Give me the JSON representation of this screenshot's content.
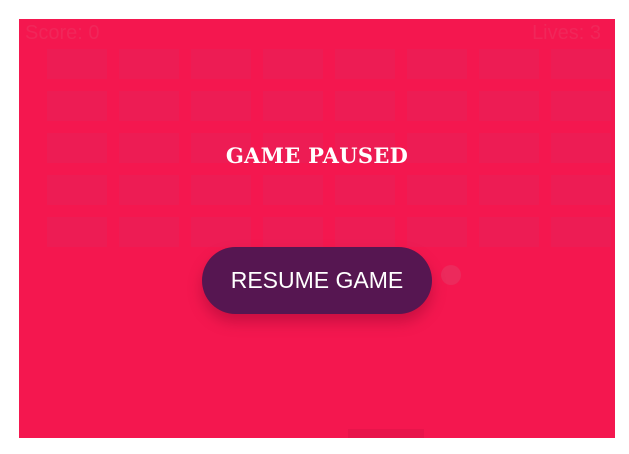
{
  "hud": {
    "score_label": "Score: 0",
    "lives_label": "Lives: 3"
  },
  "bricks": {
    "rows": 5,
    "columns": 8
  },
  "overlay": {
    "title": "GAME PAUSED",
    "resume_label": "RESUME GAME"
  },
  "colors": {
    "background": "#f4174f",
    "brick": "#ed1c54",
    "button": "#561651",
    "text": "#ffffff"
  }
}
